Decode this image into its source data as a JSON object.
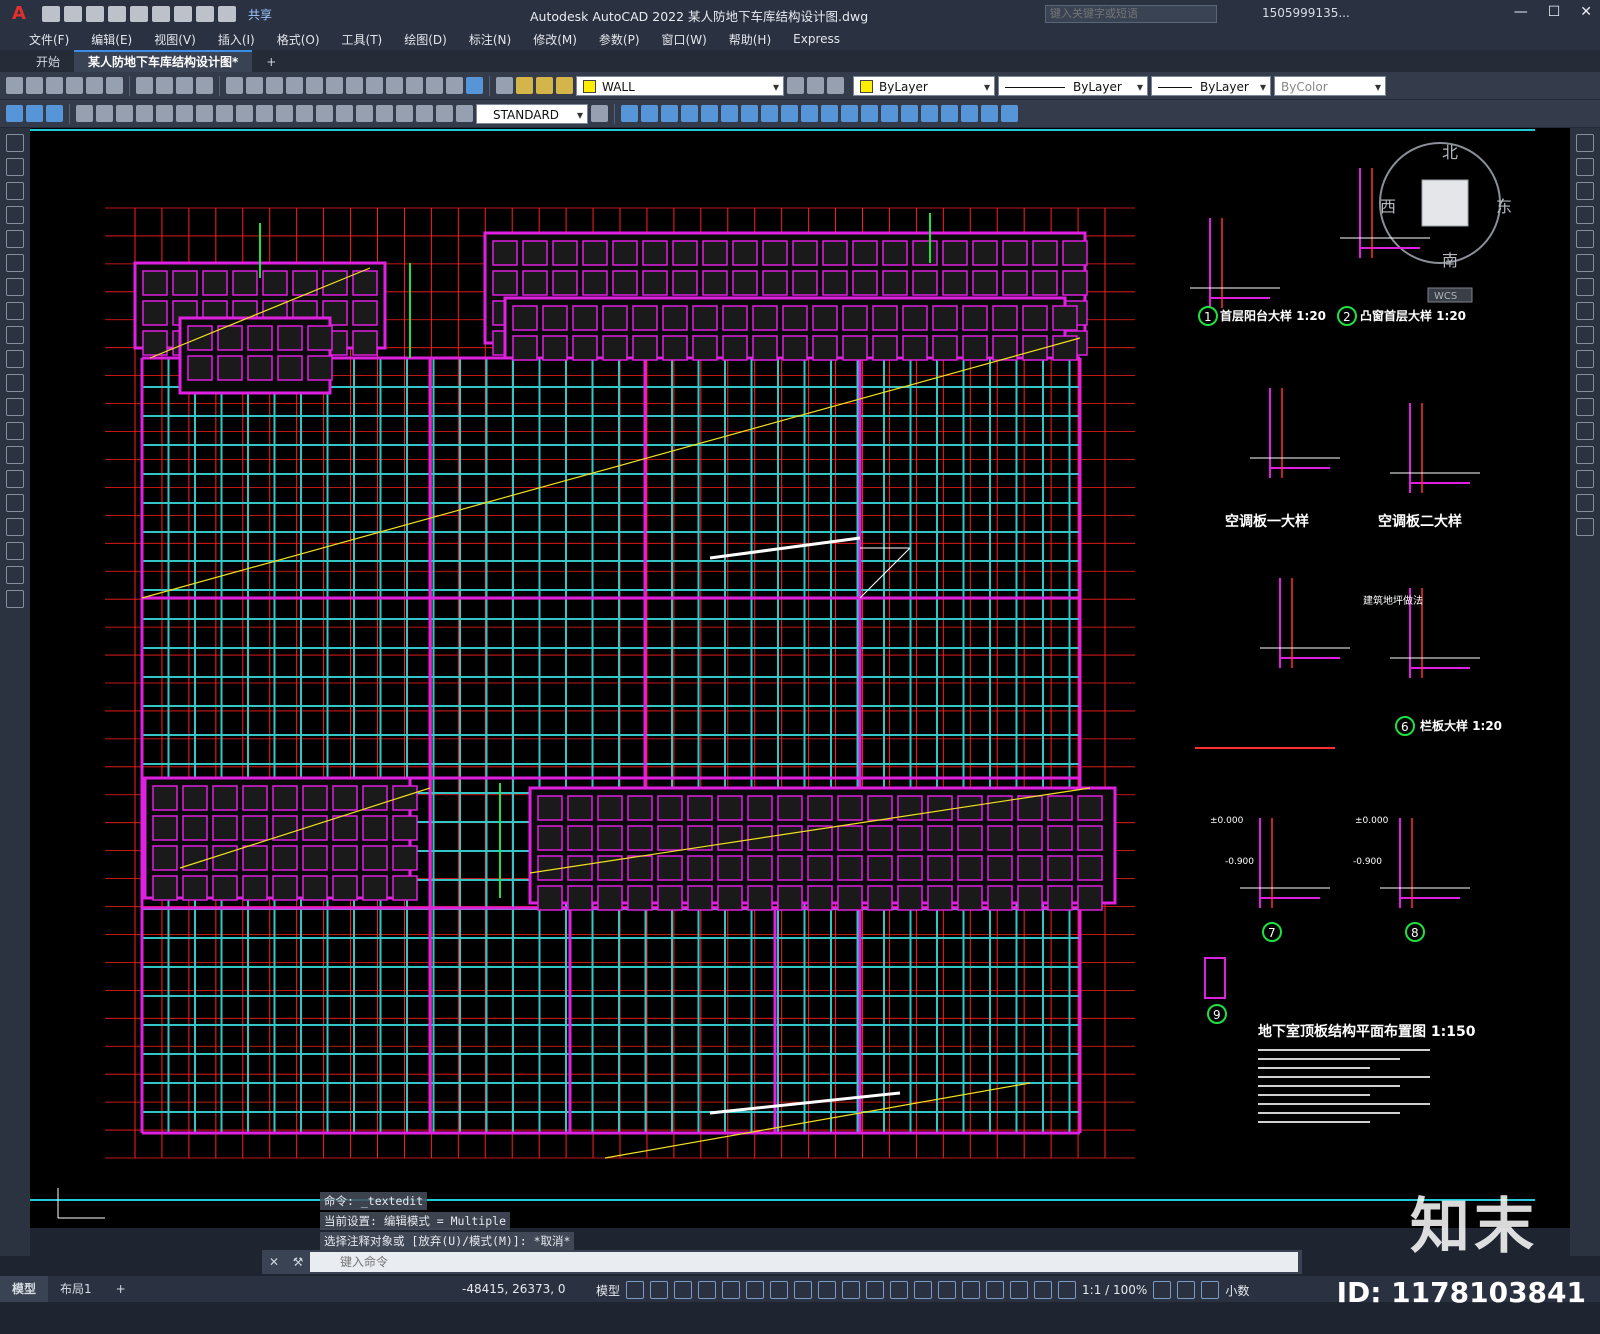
{
  "app": {
    "logo": "A",
    "title": "Autodesk AutoCAD 2022    某人防地下车库结构设计图.dwg",
    "share_label": "共享",
    "search_placeholder": "键入关键字或短语",
    "user": "1505999135...",
    "window_controls": [
      "—",
      "☐",
      "✕"
    ]
  },
  "menu": [
    "文件(F)",
    "编辑(E)",
    "视图(V)",
    "插入(I)",
    "格式(O)",
    "工具(T)",
    "绘图(D)",
    "标注(N)",
    "修改(M)",
    "参数(P)",
    "窗口(W)",
    "帮助(H)",
    "Express"
  ],
  "tabs": [
    {
      "label": "开始",
      "active": false
    },
    {
      "label": "某人防地下车库结构设计图*",
      "active": true
    },
    {
      "label": "+",
      "active": false
    }
  ],
  "toolbar": {
    "layer": "WALL",
    "color": "ByLayer",
    "linetype": "ByLayer",
    "lineweight": "ByLayer",
    "plotstyle": "ByColor",
    "textstyle": "STANDARD"
  },
  "viewcube": {
    "north": "北",
    "south": "南",
    "east": "东",
    "west": "西",
    "wcs": "WCS"
  },
  "drawing": {
    "labels": [
      "首层阳台大样 1:20",
      "凸窗首层大样 1:20",
      "空调板一大样",
      "空调板二大样",
      "栏板大样 1:20",
      "地下室顶板结构平面布置图 1:150",
      "建筑地坪做法"
    ],
    "detail_numbers": [
      "1",
      "2",
      "6",
      "7",
      "8",
      "9"
    ],
    "level_marks": [
      "±0.000",
      "-0.900",
      "±0.000",
      "-0.900"
    ]
  },
  "command": {
    "history": [
      "命令: _textedit",
      "当前设置: 编辑模式 = Multiple",
      "选择注释对象或 [放弃(U)/模式(M)]: *取消*"
    ],
    "placeholder": "键入命令"
  },
  "status": {
    "tabs": [
      "模型",
      "布局1",
      "+"
    ],
    "coords": "-48415, 26373, 0",
    "model": "模型",
    "scale": "1:1 / 100%",
    "units": "小数"
  },
  "watermark": {
    "brand": "知末",
    "id": "ID: 1178103841"
  }
}
